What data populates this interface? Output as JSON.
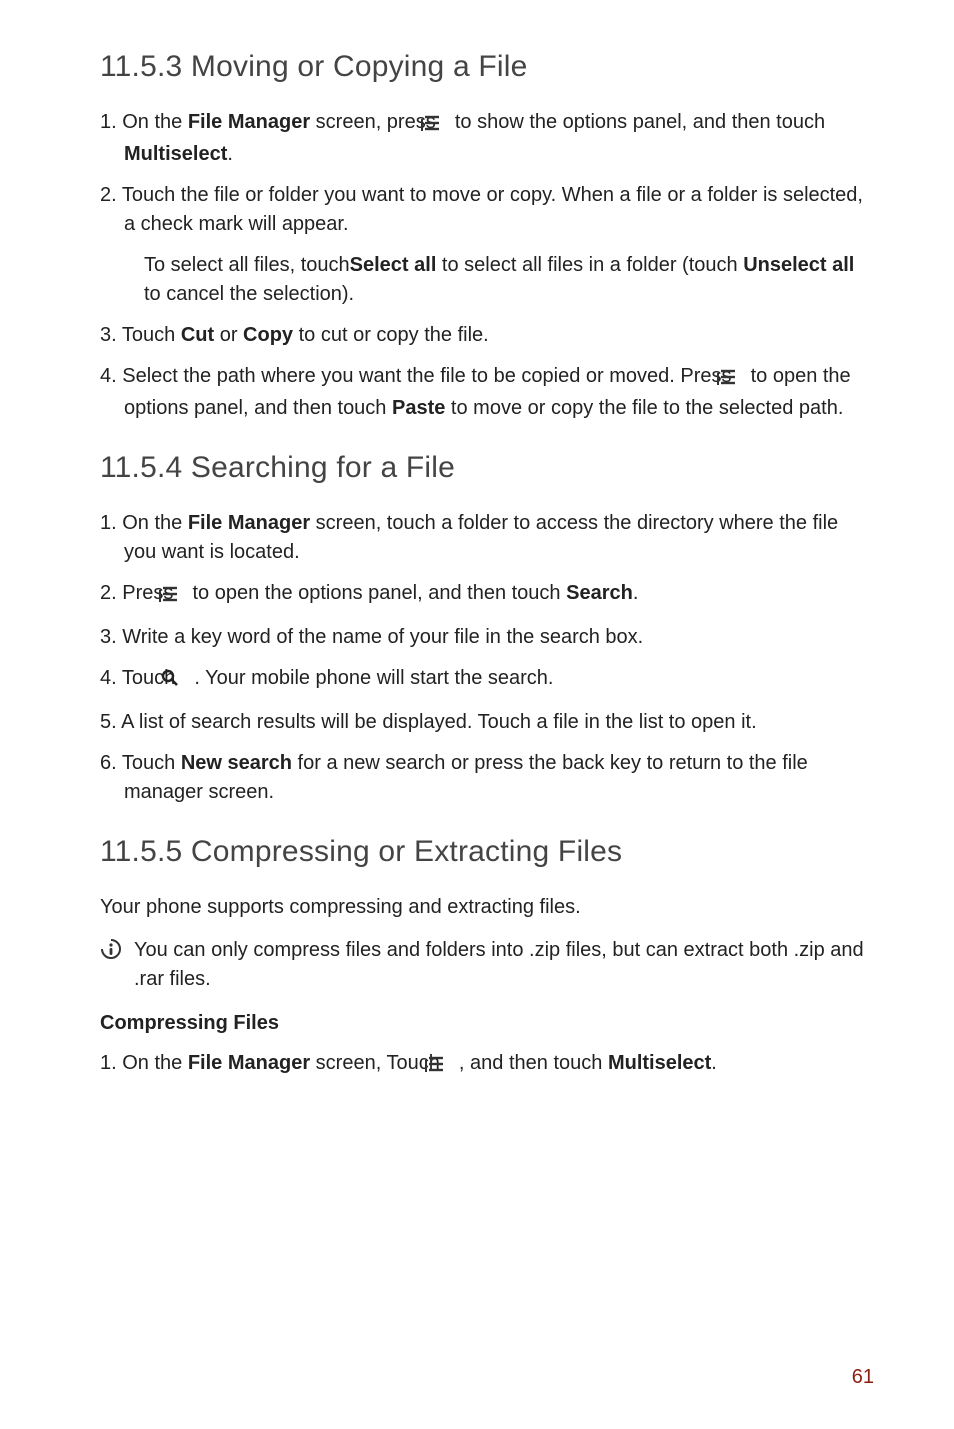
{
  "icons": {
    "menu_aria": "menu icon",
    "search_aria": "search icon",
    "info_aria": "info icon"
  },
  "s1": {
    "heading": "11.5.3  Moving or Copying a File",
    "step1_a": "1. On the ",
    "step1_b": "File Manager",
    "step1_c": " screen, press ",
    "step1_d": " to show the options panel, and then touch ",
    "step1_e": "Multiselect",
    "step1_f": ".",
    "step2": "2. Touch the file or folder you want to move or copy. When a file or a folder is selected, a check mark will appear.",
    "sub_a": "To select all files, touch",
    "sub_b": "Select all",
    "sub_c": " to select all files in a folder (touch ",
    "sub_d": "Unselect all",
    "sub_e": " to cancel the selection).",
    "step3_a": "3. Touch ",
    "step3_b": "Cut",
    "step3_c": " or ",
    "step3_d": "Copy",
    "step3_e": " to cut or copy the file.",
    "step4_a": "4. Select the path where you want the file to be copied or moved. Press ",
    "step4_b": " to open the options panel, and then touch ",
    "step4_c": "Paste",
    "step4_d": " to move or copy the file to the selected path."
  },
  "s2": {
    "heading": "11.5.4  Searching for a File",
    "step1_a": "1. On the ",
    "step1_b": "File Manager",
    "step1_c": " screen, touch a folder to access the directory where the file you want is located.",
    "step2_a": "2. Press ",
    "step2_b": " to open the options panel, and then touch ",
    "step2_c": "Search",
    "step2_d": ".",
    "step3": "3. Write a key word of the name of your file in the search box.",
    "step4_a": "4. Touch ",
    "step4_b": " . Your mobile phone will start the search.",
    "step5": "5. A list of search results will be displayed. Touch a file in the list to open it.",
    "step6_a": "6. Touch ",
    "step6_b": "New search",
    "step6_c": " for a new search or press the back key to return to the file manager screen."
  },
  "s3": {
    "heading": "11.5.5  Compressing or Extracting Files",
    "intro": "Your phone supports compressing and extracting files.",
    "note": "You can only compress files and folders into .zip files, but can extract both .zip and .rar files.",
    "subhead": "Compressing Files",
    "step1_a": "1. On the ",
    "step1_b": "File Manager",
    "step1_c": " screen, Touch ",
    "step1_d": " , and then touch ",
    "step1_e": "Multiselect",
    "step1_f": "."
  },
  "page_number": "61"
}
